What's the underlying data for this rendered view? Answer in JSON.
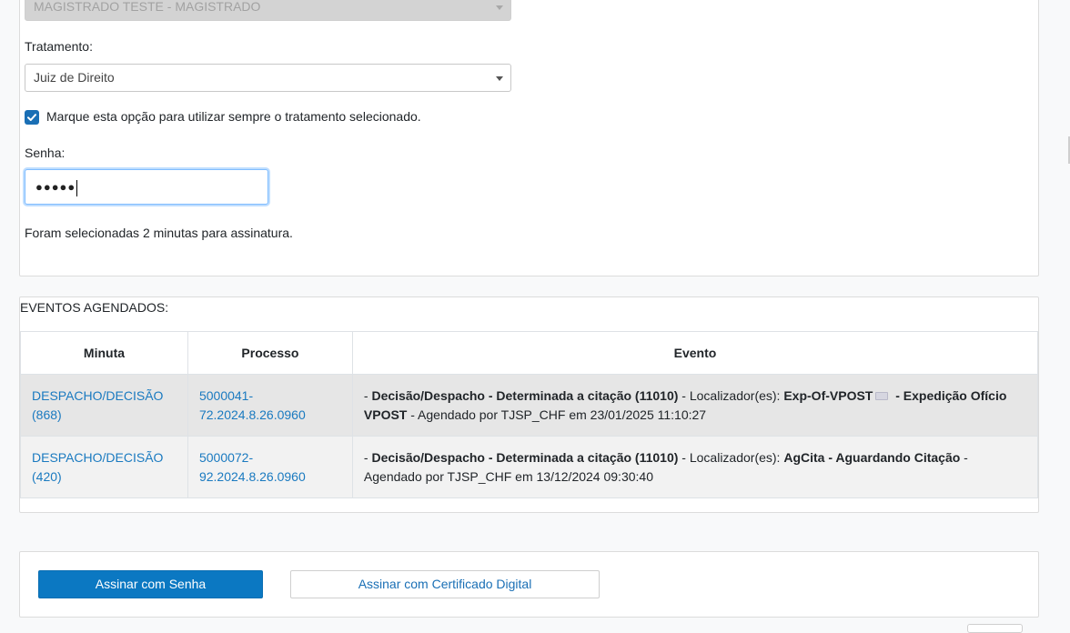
{
  "form": {
    "magistrado_value": "MAGISTRADO TESTE - MAGISTRADO",
    "tratamento_label": "Tratamento:",
    "tratamento_value": "Juiz de Direito",
    "checkbox_label": "Marque esta opção para utilizar sempre o tratamento selecionado.",
    "checkbox_checked": true,
    "senha_label": "Senha:",
    "senha_mask": "●●●●●",
    "info_text": "Foram selecionadas 2 minutas para assinatura."
  },
  "events": {
    "title": "EVENTOS AGENDADOS:",
    "columns": [
      "Minuta",
      "Processo",
      "Evento"
    ],
    "rows": [
      {
        "minuta_1": "DESPACHO/DECISÃO",
        "minuta_2": "(868)",
        "processo_1": "5000041-",
        "processo_2": "72.2024.8.26.0960",
        "evento_prefix": "- ",
        "evento_bold_1": "Decisão/Despacho - Determinada a citação (11010)",
        "evento_mid": " - Localizador(es): ",
        "evento_bold_2": "Exp-Of-VPOST",
        "evento_bold_3": " - Expedição Ofício VPOST",
        "evento_suffix": " - Agendado por TJSP_CHF em 23/01/2025 11:10:27"
      },
      {
        "minuta_1": "DESPACHO/DECISÃO",
        "minuta_2": "(420)",
        "processo_1": "5000072-",
        "processo_2": "92.2024.8.26.0960",
        "evento_prefix": "- ",
        "evento_bold_1": "Decisão/Despacho - Determinada a citação (11010)",
        "evento_mid": " - Localizador(es): ",
        "evento_bold_2": "AgCita - Aguardando Citação",
        "evento_suffix": " - Agendado por TJSP_CHF em 13/12/2024 09:30:40"
      }
    ]
  },
  "actions": {
    "sign_password": "Assinar com Senha",
    "sign_certificate": "Assinar com Certificado Digital"
  },
  "colors": {
    "primary": "#0b78c2",
    "link": "#1a7ac0",
    "checkbox": "#1a6fb5"
  }
}
